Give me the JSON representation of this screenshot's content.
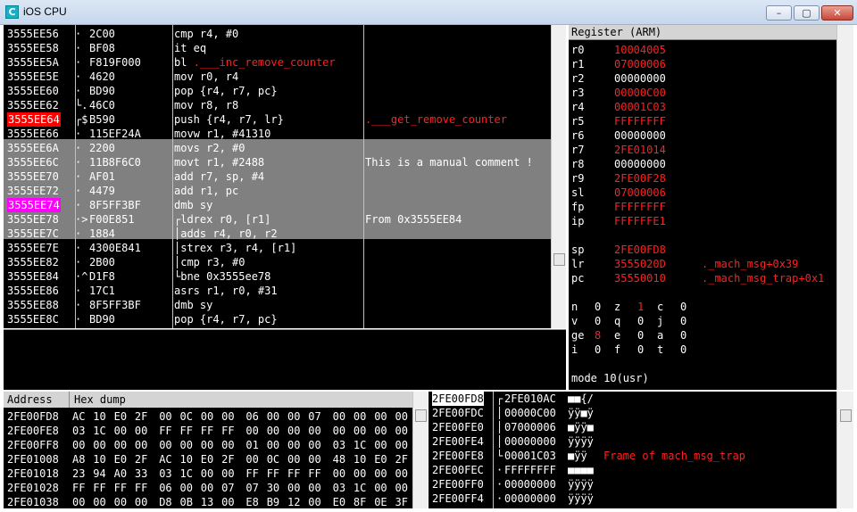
{
  "window": {
    "title": "iOS CPU",
    "icon_letter": "C",
    "minimize": "–",
    "maximize": "▢",
    "close": "✕"
  },
  "disasm": {
    "rows": [
      {
        "addr": "3555EE56",
        "mark": "·",
        "bytes": "2C00",
        "instr": "cmp r4, #0",
        "comment": ""
      },
      {
        "addr": "3555EE58",
        "mark": "·",
        "bytes": "BF08",
        "instr": "it eq",
        "comment": ""
      },
      {
        "addr": "3555EE5A",
        "mark": "·",
        "bytes": "F819F000",
        "instr": "bl ",
        "target": ".___inc_remove_counter",
        "comment": ""
      },
      {
        "addr": "3555EE5E",
        "mark": "·",
        "bytes": "4620",
        "instr": "mov r0, r4",
        "comment": ""
      },
      {
        "addr": "3555EE60",
        "mark": "·",
        "bytes": "BD90",
        "instr": "pop {r4, r7, pc}",
        "comment": ""
      },
      {
        "addr": "3555EE62",
        "mark": "└.",
        "bytes": "46C0",
        "instr": "mov r8, r8",
        "comment": ""
      },
      {
        "addr": "3555EE64",
        "mark": "┌$",
        "bytes": "B590",
        "instr": "push {r4, r7, lr}",
        "comment": ".___get_remove_counter"
      },
      {
        "addr": "3555EE66",
        "mark": "·",
        "bytes": "115EF24A",
        "instr": "movw r1, #41310",
        "comment": ""
      },
      {
        "addr": "3555EE6A",
        "mark": "·",
        "bytes": "2200",
        "instr": "movs r2, #0",
        "comment": ""
      },
      {
        "addr": "3555EE6C",
        "mark": "·",
        "bytes": "11B8F6C0",
        "instr": "movt r1, #2488",
        "comment": "This is a manual comment !"
      },
      {
        "addr": "3555EE70",
        "mark": "·",
        "bytes": "AF01",
        "instr": "add r7, sp, #4",
        "comment": ""
      },
      {
        "addr": "3555EE72",
        "mark": "·",
        "bytes": "4479",
        "instr": "add r1, pc",
        "comment": ""
      },
      {
        "addr": "3555EE74",
        "mark": "·",
        "bytes": "8F5FF3BF",
        "instr": "dmb sy",
        "comment": ""
      },
      {
        "addr": "3555EE78",
        "mark": "·>",
        "bytes": "F00E851",
        "instr": "┌ldrex r0, [r1]",
        "comment": "From 0x3555EE84"
      },
      {
        "addr": "3555EE7C",
        "mark": "·",
        "bytes": "1884",
        "instr": "│adds r4, r0, r2",
        "comment": ""
      },
      {
        "addr": "3555EE7E",
        "mark": "·",
        "bytes": "4300E841",
        "instr": "│strex r3, r4, [r1]",
        "comment": ""
      },
      {
        "addr": "3555EE82",
        "mark": "·",
        "bytes": "2B00",
        "instr": "│cmp r3, #0",
        "comment": ""
      },
      {
        "addr": "3555EE84",
        "mark": "·^",
        "bytes": "D1F8",
        "instr": "└bne 0x3555ee78",
        "comment": ""
      },
      {
        "addr": "3555EE86",
        "mark": "·",
        "bytes": "17C1",
        "instr": "asrs r1, r0, #31",
        "comment": ""
      },
      {
        "addr": "3555EE88",
        "mark": "·",
        "bytes": "8F5FF3BF",
        "instr": "dmb sy",
        "comment": ""
      },
      {
        "addr": "3555EE8C",
        "mark": "·",
        "bytes": "BD90",
        "instr": "pop {r4, r7, pc}",
        "comment": ""
      }
    ]
  },
  "registers": {
    "header": "Register (ARM)",
    "rows": [
      {
        "name": "r0",
        "value": "10004005",
        "changed": true
      },
      {
        "name": "r1",
        "value": "07000006",
        "changed": true
      },
      {
        "name": "r2",
        "value": "00000000",
        "changed": false
      },
      {
        "name": "r3",
        "value": "00000C00",
        "changed": true
      },
      {
        "name": "r4",
        "value": "00001C03",
        "changed": true
      },
      {
        "name": "r5",
        "value": "FFFFFFFF",
        "changed": true
      },
      {
        "name": "r6",
        "value": "00000000",
        "changed": false
      },
      {
        "name": "r7",
        "value": "2FE01014",
        "changed": true
      },
      {
        "name": "r8",
        "value": "00000000",
        "changed": false
      },
      {
        "name": "r9",
        "value": "2FE00F28",
        "changed": true
      },
      {
        "name": "sl",
        "value": "07000006",
        "changed": true
      },
      {
        "name": "fp",
        "value": "FFFFFFFF",
        "changed": true
      },
      {
        "name": "ip",
        "value": "FFFFFFE1",
        "changed": true
      }
    ],
    "special": [
      {
        "name": "sp",
        "value": "2FE00FD8",
        "comment": ""
      },
      {
        "name": "lr",
        "value": "3555020D",
        "comment": "._mach_msg+0x39"
      },
      {
        "name": "pc",
        "value": "35550010",
        "comment": "._mach_msg_trap+0x1"
      }
    ],
    "flags": [
      [
        "n",
        "0",
        "z",
        "1",
        "c",
        "0"
      ],
      [
        "v",
        "0",
        "q",
        "0",
        "j",
        "0"
      ],
      [
        "ge",
        "8",
        "e",
        "0",
        "a",
        "0"
      ],
      [
        "i",
        "0",
        "f",
        "0",
        "t",
        "0"
      ]
    ],
    "mode": "mode 10(usr)"
  },
  "hexdump": {
    "header_addr": "Address",
    "header_dump": "Hex dump",
    "rows": [
      {
        "addr": "2FE00FD8",
        "bytes": [
          "AC",
          "10",
          "E0",
          "2F",
          "00",
          "0C",
          "00",
          "00",
          "06",
          "00",
          "00",
          "07",
          "00",
          "00",
          "00",
          "00"
        ]
      },
      {
        "addr": "2FE00FE8",
        "bytes": [
          "03",
          "1C",
          "00",
          "00",
          "FF",
          "FF",
          "FF",
          "FF",
          "00",
          "00",
          "00",
          "00",
          "00",
          "00",
          "00",
          "00"
        ]
      },
      {
        "addr": "2FE00FF8",
        "bytes": [
          "00",
          "00",
          "00",
          "00",
          "00",
          "00",
          "00",
          "00",
          "01",
          "00",
          "00",
          "00",
          "03",
          "1C",
          "00",
          "00"
        ]
      },
      {
        "addr": "2FE01008",
        "bytes": [
          "A8",
          "10",
          "E0",
          "2F",
          "AC",
          "10",
          "E0",
          "2F",
          "00",
          "0C",
          "00",
          "00",
          "48",
          "10",
          "E0",
          "2F"
        ]
      },
      {
        "addr": "2FE01018",
        "bytes": [
          "23",
          "94",
          "A0",
          "33",
          "03",
          "1C",
          "00",
          "00",
          "FF",
          "FF",
          "FF",
          "FF",
          "00",
          "00",
          "00",
          "00"
        ]
      },
      {
        "addr": "2FE01028",
        "bytes": [
          "FF",
          "FF",
          "FF",
          "FF",
          "06",
          "00",
          "00",
          "07",
          "07",
          "30",
          "00",
          "00",
          "03",
          "1C",
          "00",
          "00"
        ]
      },
      {
        "addr": "2FE01038",
        "bytes": [
          "00",
          "00",
          "00",
          "00",
          "D8",
          "0B",
          "13",
          "00",
          "E8",
          "B9",
          "12",
          "00",
          "E0",
          "8F",
          "0E",
          "3F"
        ]
      }
    ]
  },
  "stack": {
    "rows": [
      {
        "addr": "2FE00FD8",
        "link": "┌",
        "value": "2FE010AC",
        "ascii": "■■{/",
        "comment": ""
      },
      {
        "addr": "2FE00FDC",
        "link": "│",
        "value": "00000C00",
        "ascii": "ÿÿ■ÿ",
        "comment": ""
      },
      {
        "addr": "2FE00FE0",
        "link": "│",
        "value": "07000006",
        "ascii": "■ÿÿ■",
        "comment": ""
      },
      {
        "addr": "2FE00FE4",
        "link": "│",
        "value": "00000000",
        "ascii": "ÿÿÿÿ",
        "comment": ""
      },
      {
        "addr": "2FE00FE8",
        "link": "└",
        "value": "00001C03",
        "ascii": "■ÿÿ",
        "comment": "Frame of mach_msg_trap"
      },
      {
        "addr": "2FE00FEC",
        "link": "·",
        "value": "FFFFFFFF",
        "ascii": "■■■■",
        "comment": ""
      },
      {
        "addr": "2FE00FF0",
        "link": "·",
        "value": "00000000",
        "ascii": "ÿÿÿÿ",
        "comment": ""
      },
      {
        "addr": "2FE00FF4",
        "link": "·",
        "value": "00000000",
        "ascii": "ÿÿÿÿ",
        "comment": ""
      }
    ]
  },
  "colors": {
    "changed_register": "#ff2020",
    "label": "#ff2020",
    "selected_line": "#808080",
    "pc_marker": "#ff00ff",
    "bp_marker": "#ff0000"
  }
}
